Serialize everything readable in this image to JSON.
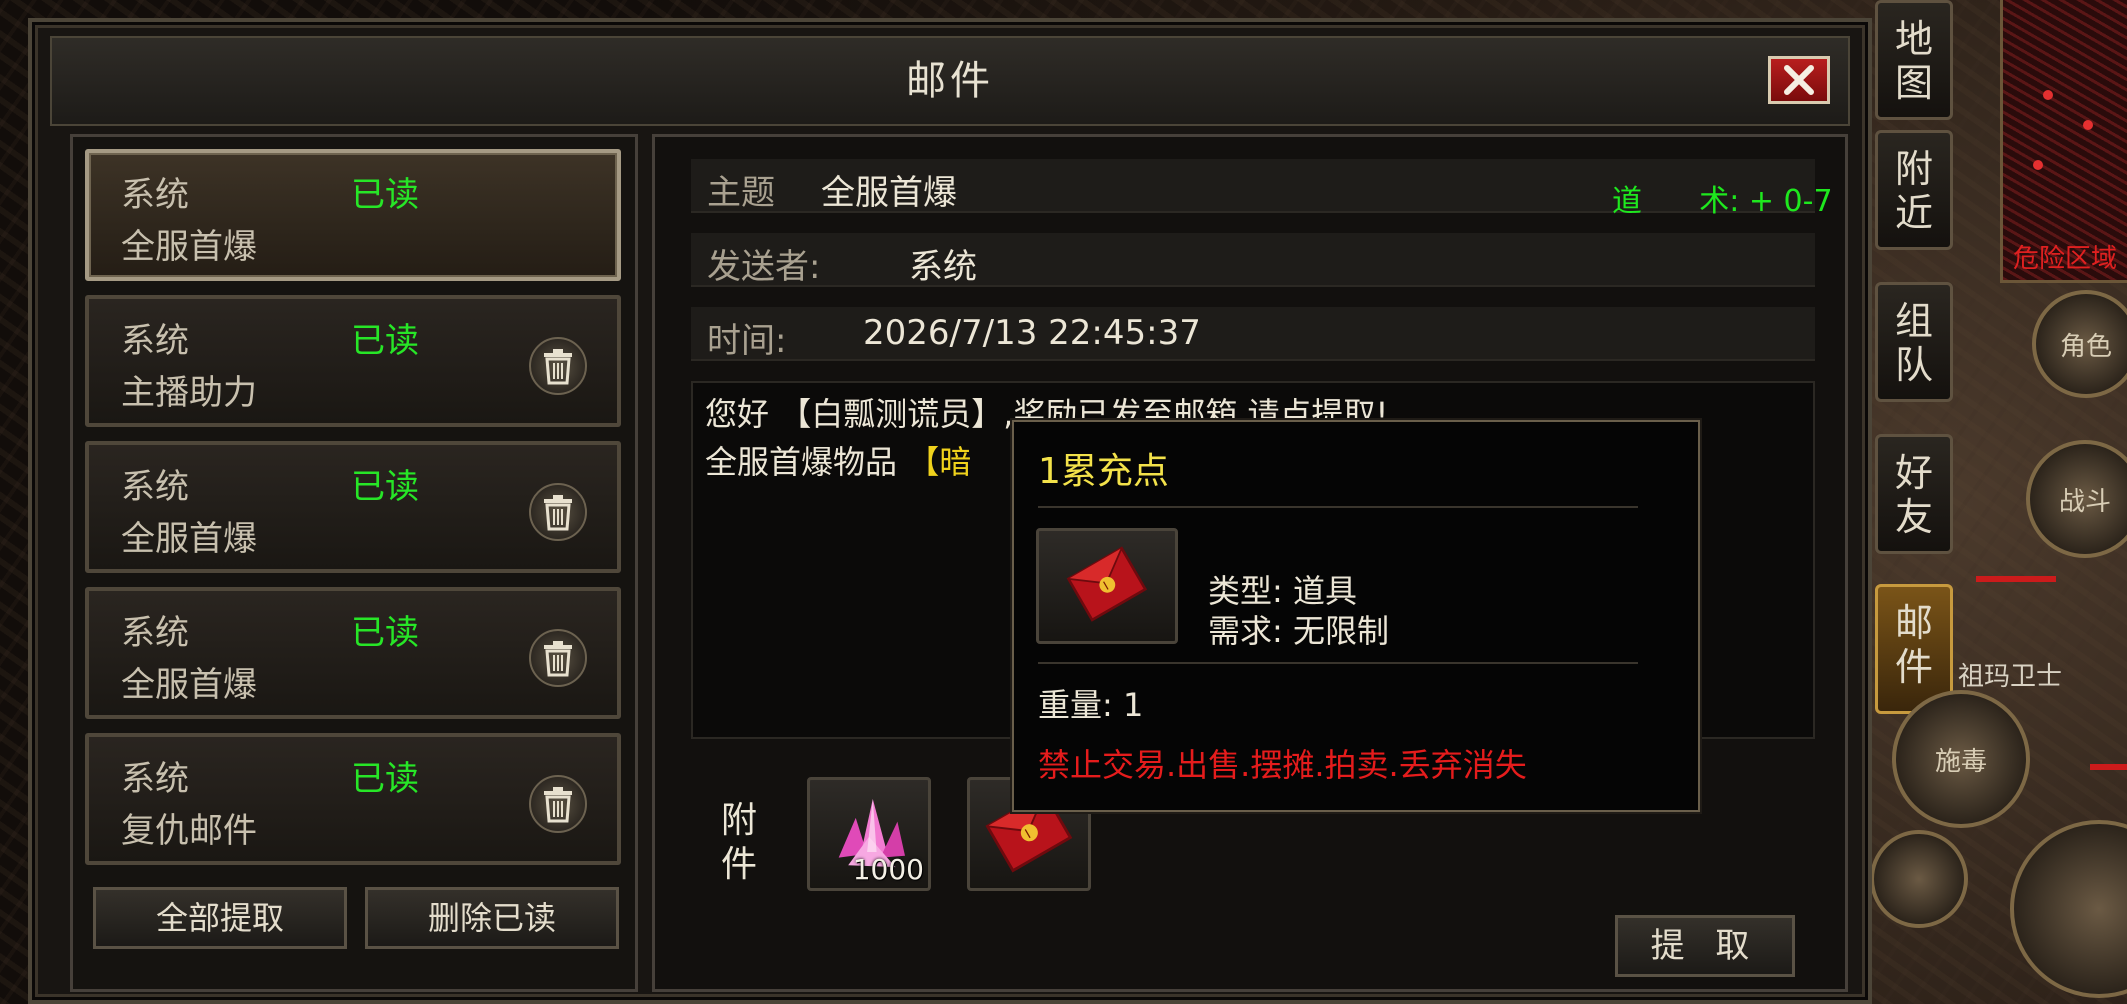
{
  "window": {
    "title": "邮件"
  },
  "mail_list": {
    "items": [
      {
        "sender": "系统",
        "status": "已读",
        "subject": "全服首爆"
      },
      {
        "sender": "系统",
        "status": "已读",
        "subject": "主播助力"
      },
      {
        "sender": "系统",
        "status": "已读",
        "subject": "全服首爆"
      },
      {
        "sender": "系统",
        "status": "已读",
        "subject": "全服首爆"
      },
      {
        "sender": "系统",
        "status": "已读",
        "subject": "复仇邮件"
      }
    ],
    "claim_all_label": "全部提取",
    "delete_read_label": "删除已读"
  },
  "detail": {
    "subject_label": "主题",
    "subject_value": "全服首爆",
    "sender_label": "发送者:",
    "sender_value": "系统",
    "time_label": "时间:",
    "time_value": "2026/7/13 22:45:37",
    "body_line1_prefix": "您好",
    "body_line1_name": "【白瓢测谎员】",
    "body_line1_suffix": ",奖励已发至邮箱,请点提取!",
    "body_line2_prefix": "全服首爆物品",
    "body_line2_item": "【暗",
    "attachments_label": "附件",
    "attachments": [
      {
        "icon": "crystal-icon",
        "quantity": "1000"
      },
      {
        "icon": "red-envelope-icon"
      }
    ],
    "claim_label": "提 取"
  },
  "float_text": "道      术: + 0-7",
  "tooltip": {
    "title": "1累充点",
    "icon": "red-envelope-icon",
    "type_label": "类型:",
    "type_value": "道具",
    "req_label": "需求:",
    "req_value": "无限制",
    "weight_label": "重量:",
    "weight_value": "1",
    "warning": "禁止交易.出售.摆摊.拍卖.丢弃消失"
  },
  "game_hud": {
    "tabs": [
      "地图",
      "附近",
      "组队",
      "好友",
      "邮件"
    ],
    "danger_zone": "危险区域",
    "buttons": [
      "角色",
      "战斗",
      "施毒"
    ],
    "npc_name": "祖玛卫士"
  },
  "colors": {
    "read_status": "#27e627",
    "tooltip_title": "#f3e24a",
    "warning": "#e51c1c",
    "highlight": "#f0d21c",
    "close_button": "#b81e1e"
  }
}
